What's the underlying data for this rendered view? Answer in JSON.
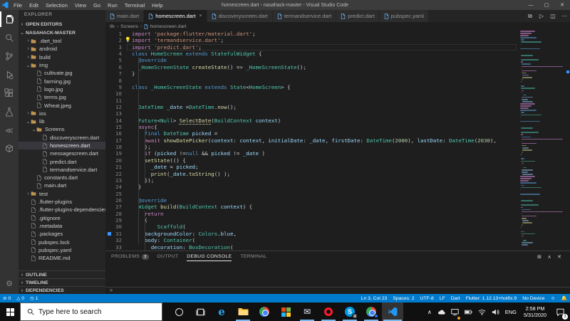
{
  "window": {
    "title": "homescreen.dart - nasahack-master - Visual Studio Code"
  },
  "menu": {
    "items": [
      "File",
      "Edit",
      "Selection",
      "View",
      "Go",
      "Run",
      "Terminal",
      "Help"
    ]
  },
  "activity_bar": {
    "icons": [
      {
        "name": "explorer",
        "active": true
      },
      {
        "name": "search",
        "active": false
      },
      {
        "name": "source-control",
        "active": false
      },
      {
        "name": "run-debug",
        "active": false
      },
      {
        "name": "extensions",
        "active": false
      },
      {
        "name": "test",
        "active": false
      },
      {
        "name": "flutter-outline",
        "active": false
      },
      {
        "name": "package-explorer",
        "active": false
      }
    ],
    "bottom_icons": [
      {
        "name": "settings"
      }
    ]
  },
  "sidebar": {
    "title": "EXPLORER",
    "open_editors": "OPEN EDITORS",
    "root": "NASAHACK-MASTER",
    "tree": [
      {
        "label": ".dart_tool",
        "type": "folder",
        "indent": 1,
        "open": false
      },
      {
        "label": "android",
        "type": "folder",
        "indent": 1,
        "open": false
      },
      {
        "label": "build",
        "type": "folder",
        "indent": 1,
        "open": false
      },
      {
        "label": "img",
        "type": "folder",
        "indent": 1,
        "open": true
      },
      {
        "label": "cultivate.jpg",
        "type": "file",
        "indent": 2
      },
      {
        "label": "farming.jpg",
        "type": "file",
        "indent": 2
      },
      {
        "label": "logo.jpg",
        "type": "file",
        "indent": 2
      },
      {
        "label": "terms.jpg",
        "type": "file",
        "indent": 2
      },
      {
        "label": "Wheat.jpeg",
        "type": "file",
        "indent": 2
      },
      {
        "label": "ios",
        "type": "folder",
        "indent": 1,
        "open": false
      },
      {
        "label": "lib",
        "type": "folder",
        "indent": 1,
        "open": true
      },
      {
        "label": "Screens",
        "type": "folder",
        "indent": 2,
        "open": true
      },
      {
        "label": "discoveryscreen.dart",
        "type": "file",
        "indent": 3
      },
      {
        "label": "homescreen.dart",
        "type": "file",
        "indent": 3,
        "selected": true
      },
      {
        "label": "messagescreen.dart",
        "type": "file",
        "indent": 3
      },
      {
        "label": "predict.dart",
        "type": "file",
        "indent": 3
      },
      {
        "label": "termandservice.dart",
        "type": "file",
        "indent": 3
      },
      {
        "label": "constants.dart",
        "type": "file",
        "indent": 2
      },
      {
        "label": "main.dart",
        "type": "file",
        "indent": 2
      },
      {
        "label": "test",
        "type": "folder",
        "indent": 1,
        "open": false
      },
      {
        "label": ".flutter-plugins",
        "type": "file",
        "indent": 1
      },
      {
        "label": ".flutter-plugins-dependencies",
        "type": "file",
        "indent": 1
      },
      {
        "label": ".gitignore",
        "type": "file",
        "indent": 1
      },
      {
        "label": ".metadata",
        "type": "file",
        "indent": 1
      },
      {
        "label": ".packages",
        "type": "file",
        "indent": 1
      },
      {
        "label": "pubspec.lock",
        "type": "file",
        "indent": 1
      },
      {
        "label": "pubspec.yaml",
        "type": "file",
        "indent": 1
      },
      {
        "label": "README.md",
        "type": "file",
        "indent": 1
      }
    ],
    "bottom_sections": [
      "OUTLINE",
      "TIMELINE",
      "DEPENDENCIES"
    ]
  },
  "editor": {
    "tabs": [
      {
        "label": "main.dart",
        "active": false,
        "closable": false
      },
      {
        "label": "homescreen.dart",
        "active": true,
        "closable": true
      },
      {
        "label": "discoveryscreen.dart",
        "active": false,
        "closable": false
      },
      {
        "label": "termandservice.dart",
        "active": false,
        "closable": false
      },
      {
        "label": "predict.dart",
        "active": false,
        "closable": false
      },
      {
        "label": "pubspec.yaml",
        "active": false,
        "closable": false
      }
    ],
    "actions": [
      {
        "name": "open-changes",
        "glyph": "⧉"
      },
      {
        "name": "run",
        "glyph": "▷"
      },
      {
        "name": "split-editor",
        "glyph": "◫"
      },
      {
        "name": "more-actions",
        "glyph": "⋯"
      }
    ],
    "breadcrumb": [
      "lib",
      "Screens",
      "homescreen.dart"
    ],
    "close_glyph": "×",
    "code_lines": [
      {
        "n": 1,
        "tokens": [
          [
            "import",
            "kw"
          ],
          [
            " ",
            "pl"
          ],
          [
            "'package:flutter/material.dart'",
            "st"
          ],
          [
            ";",
            "pl"
          ]
        ]
      },
      {
        "n": 2,
        "lightbulb": true,
        "tokens": [
          [
            "import",
            "kw"
          ],
          [
            " ",
            "pl"
          ],
          [
            "'termandservice.dart'",
            "st"
          ],
          [
            ";",
            "pl"
          ]
        ]
      },
      {
        "n": 3,
        "current": true,
        "tokens": [
          [
            "import",
            "kw"
          ],
          [
            " ",
            "pl"
          ],
          [
            "'predict.dart'",
            "st"
          ],
          [
            ";",
            "pl"
          ]
        ]
      },
      {
        "n": 4,
        "tokens": [
          [
            "class",
            "kb"
          ],
          [
            " ",
            "pl"
          ],
          [
            "HomeScreen",
            "ty"
          ],
          [
            " ",
            "pl"
          ],
          [
            "extends",
            "kb"
          ],
          [
            " ",
            "pl"
          ],
          [
            "StatefulWidget",
            "ty"
          ],
          [
            " {",
            "pl"
          ]
        ]
      },
      {
        "n": 5,
        "tokens": [
          [
            "  ",
            "pl"
          ],
          [
            "@override",
            "kb"
          ]
        ]
      },
      {
        "n": 6,
        "tokens": [
          [
            "  ",
            "pl"
          ],
          [
            "_HomeScreenState",
            "ty"
          ],
          [
            " ",
            "pl"
          ],
          [
            "createState",
            "fn"
          ],
          [
            "() => ",
            "pl"
          ],
          [
            "_HomeScreenState",
            "ty"
          ],
          [
            "();",
            "pl"
          ]
        ]
      },
      {
        "n": 7,
        "tokens": [
          [
            "}",
            "pl"
          ]
        ]
      },
      {
        "n": 8,
        "tokens": []
      },
      {
        "n": 9,
        "tokens": [
          [
            "class",
            "kb"
          ],
          [
            " ",
            "pl"
          ],
          [
            "_HomeScreenState",
            "ty"
          ],
          [
            " ",
            "pl"
          ],
          [
            "extends",
            "kb"
          ],
          [
            " ",
            "pl"
          ],
          [
            "State",
            "ty"
          ],
          [
            "<",
            "pl"
          ],
          [
            "HomeScreen",
            "ty"
          ],
          [
            "> {",
            "pl"
          ]
        ]
      },
      {
        "n": 10,
        "tokens": []
      },
      {
        "n": 11,
        "tokens": []
      },
      {
        "n": 12,
        "tokens": [
          [
            "  ",
            "pl"
          ],
          [
            "DateTime",
            "ty"
          ],
          [
            " ",
            "pl"
          ],
          [
            "_date",
            "va"
          ],
          [
            " =",
            "pl"
          ],
          [
            "DateTime",
            "ty"
          ],
          [
            ".",
            "pl"
          ],
          [
            "now",
            "fn"
          ],
          [
            "();",
            "pl"
          ]
        ]
      },
      {
        "n": 13,
        "tokens": []
      },
      {
        "n": 14,
        "tokens": [
          [
            "  ",
            "pl"
          ],
          [
            "Future",
            "ty"
          ],
          [
            "<",
            "pl"
          ],
          [
            "Null",
            "ty"
          ],
          [
            "> ",
            "pl"
          ],
          [
            "SelectDate",
            "fnu"
          ],
          [
            "(",
            "pl"
          ],
          [
            "BuildContext",
            "ty"
          ],
          [
            " ",
            "pl"
          ],
          [
            "context",
            "va"
          ],
          [
            ")",
            "pl"
          ]
        ]
      },
      {
        "n": 15,
        "tokens": [
          [
            "  ",
            "pl"
          ],
          [
            "async",
            "kw"
          ],
          [
            "{",
            "pl"
          ]
        ]
      },
      {
        "n": 16,
        "tokens": [
          [
            "    ",
            "pl"
          ],
          [
            "final",
            "kb"
          ],
          [
            " ",
            "pl"
          ],
          [
            "DateTime",
            "ty"
          ],
          [
            " ",
            "pl"
          ],
          [
            "picked",
            "va"
          ],
          [
            " =",
            "pl"
          ]
        ]
      },
      {
        "n": 17,
        "tokens": [
          [
            "    ",
            "pl"
          ],
          [
            "await",
            "kw"
          ],
          [
            " ",
            "pl"
          ],
          [
            "showDatePicker",
            "fn"
          ],
          [
            "(",
            "pl"
          ],
          [
            "context",
            "va"
          ],
          [
            ": ",
            "pl"
          ],
          [
            "context",
            "va"
          ],
          [
            ", ",
            "pl"
          ],
          [
            "initialDate",
            "va"
          ],
          [
            ": ",
            "pl"
          ],
          [
            "_date",
            "va"
          ],
          [
            ", ",
            "pl"
          ],
          [
            "firstDate",
            "va"
          ],
          [
            ": ",
            "pl"
          ],
          [
            "DateTime",
            "ty"
          ],
          [
            "(",
            "pl"
          ],
          [
            "2000",
            "nu"
          ],
          [
            "), ",
            "pl"
          ],
          [
            "lastDate",
            "va"
          ],
          [
            ": ",
            "pl"
          ],
          [
            "DateTime",
            "ty"
          ],
          [
            "(",
            "pl"
          ],
          [
            "2030",
            "nu"
          ],
          [
            "),",
            "pl"
          ]
        ]
      },
      {
        "n": 18,
        "tokens": [
          [
            "    );",
            "pl"
          ]
        ]
      },
      {
        "n": 19,
        "tokens": [
          [
            "    ",
            "pl"
          ],
          [
            "if",
            "kw"
          ],
          [
            " (",
            "pl"
          ],
          [
            "picked",
            "va"
          ],
          [
            " !=",
            "pl"
          ],
          [
            "null",
            "kb"
          ],
          [
            " && ",
            "pl"
          ],
          [
            "picked",
            "va"
          ],
          [
            " != ",
            "pl"
          ],
          [
            "_date",
            "va"
          ],
          [
            " )",
            "pl"
          ]
        ]
      },
      {
        "n": 20,
        "tokens": [
          [
            "    ",
            "pl"
          ],
          [
            "setState",
            "fn"
          ],
          [
            "(() {",
            "pl"
          ]
        ]
      },
      {
        "n": 21,
        "tokens": [
          [
            "      ",
            "pl"
          ],
          [
            "_date",
            "va"
          ],
          [
            " = ",
            "pl"
          ],
          [
            "picked",
            "va"
          ],
          [
            ";",
            "pl"
          ]
        ]
      },
      {
        "n": 22,
        "tokens": [
          [
            "      ",
            "pl"
          ],
          [
            "print",
            "fn"
          ],
          [
            "(",
            "pl"
          ],
          [
            "_date",
            "va"
          ],
          [
            ".",
            "pl"
          ],
          [
            "toString",
            "fn"
          ],
          [
            "() );",
            "pl"
          ]
        ]
      },
      {
        "n": 23,
        "tokens": [
          [
            "    });",
            "pl"
          ]
        ]
      },
      {
        "n": 24,
        "tokens": [
          [
            "  }",
            "pl"
          ]
        ]
      },
      {
        "n": 25,
        "tokens": []
      },
      {
        "n": 26,
        "tokens": [
          [
            "  ",
            "pl"
          ],
          [
            "@override",
            "kb"
          ]
        ]
      },
      {
        "n": 27,
        "tokens": [
          [
            "  ",
            "pl"
          ],
          [
            "Widget",
            "ty"
          ],
          [
            " ",
            "pl"
          ],
          [
            "build",
            "fn"
          ],
          [
            "(",
            "pl"
          ],
          [
            "BuildContext",
            "ty"
          ],
          [
            " ",
            "pl"
          ],
          [
            "context",
            "va"
          ],
          [
            ") {",
            "pl"
          ]
        ]
      },
      {
        "n": 28,
        "tokens": [
          [
            "    ",
            "pl"
          ],
          [
            "return",
            "kw"
          ]
        ]
      },
      {
        "n": 29,
        "tokens": [
          [
            "    (",
            "pl"
          ]
        ]
      },
      {
        "n": 30,
        "tokens": [
          [
            "        ",
            "pl"
          ],
          [
            "Scaffold",
            "ty"
          ],
          [
            "(",
            "pl"
          ]
        ]
      },
      {
        "n": 31,
        "marker": true,
        "tokens": [
          [
            "    ",
            "pl"
          ],
          [
            "backgroundColor",
            "va"
          ],
          [
            ": ",
            "pl"
          ],
          [
            "Colors",
            "ty"
          ],
          [
            ".",
            "pl"
          ],
          [
            "blue",
            "va"
          ],
          [
            ",",
            "pl"
          ]
        ]
      },
      {
        "n": 32,
        "tokens": [
          [
            "    ",
            "pl"
          ],
          [
            "body",
            "va"
          ],
          [
            ": ",
            "pl"
          ],
          [
            "Container",
            "ty"
          ],
          [
            "(",
            "pl"
          ]
        ]
      },
      {
        "n": 33,
        "tokens": [
          [
            "      ",
            "pl"
          ],
          [
            "decoration",
            "va"
          ],
          [
            ": ",
            "pl"
          ],
          [
            "BoxDecoration",
            "ty"
          ],
          [
            "(",
            "pl"
          ]
        ]
      }
    ]
  },
  "panel": {
    "tabs": [
      {
        "label": "PROBLEMS",
        "badge": "3",
        "active": false
      },
      {
        "label": "OUTPUT",
        "active": false
      },
      {
        "label": "DEBUG CONSOLE",
        "active": true
      },
      {
        "label": "TERMINAL",
        "active": false
      }
    ],
    "actions": [
      {
        "name": "open-in-editor",
        "glyph": "⊞"
      },
      {
        "name": "maximize",
        "glyph": "∧"
      },
      {
        "name": "close",
        "glyph": "✕"
      }
    ],
    "input_prompt": ">"
  },
  "status_bar": {
    "accent": "#007acc",
    "left": [
      {
        "icon": "error",
        "glyph": "⊘",
        "text": "0"
      },
      {
        "icon": "warning",
        "glyph": "△",
        "text": "0"
      },
      {
        "icon": "clock",
        "glyph": "◷",
        "text": "1"
      }
    ],
    "right": [
      "Ln 3, Col 23",
      "Spaces: 2",
      "UTF-8",
      "LF",
      "Dart",
      "Flutter: 1.12.13+hotfix.9",
      "No Device"
    ],
    "right_icons": [
      {
        "name": "feedback",
        "glyph": "☺"
      },
      {
        "name": "notifications",
        "glyph": "🔔"
      }
    ]
  },
  "taskbar": {
    "search_placeholder": "Type here to search",
    "apps": [
      {
        "name": "cortana",
        "running": false
      },
      {
        "name": "task-view",
        "running": false
      },
      {
        "name": "edge",
        "running": false
      },
      {
        "name": "file-explorer",
        "running": true
      },
      {
        "name": "chrome",
        "running": false
      },
      {
        "name": "store",
        "running": false
      },
      {
        "name": "mail",
        "running": true
      },
      {
        "name": "opera",
        "running": true
      },
      {
        "name": "skype",
        "running": true,
        "badge": "4"
      },
      {
        "name": "chrome-2",
        "running": true,
        "dot": true
      },
      {
        "name": "vscode",
        "running": true,
        "active": true
      }
    ],
    "tray": {
      "language": "ENG",
      "time": "2:58 PM",
      "date": "5/31/2020",
      "notifications": "3"
    }
  }
}
